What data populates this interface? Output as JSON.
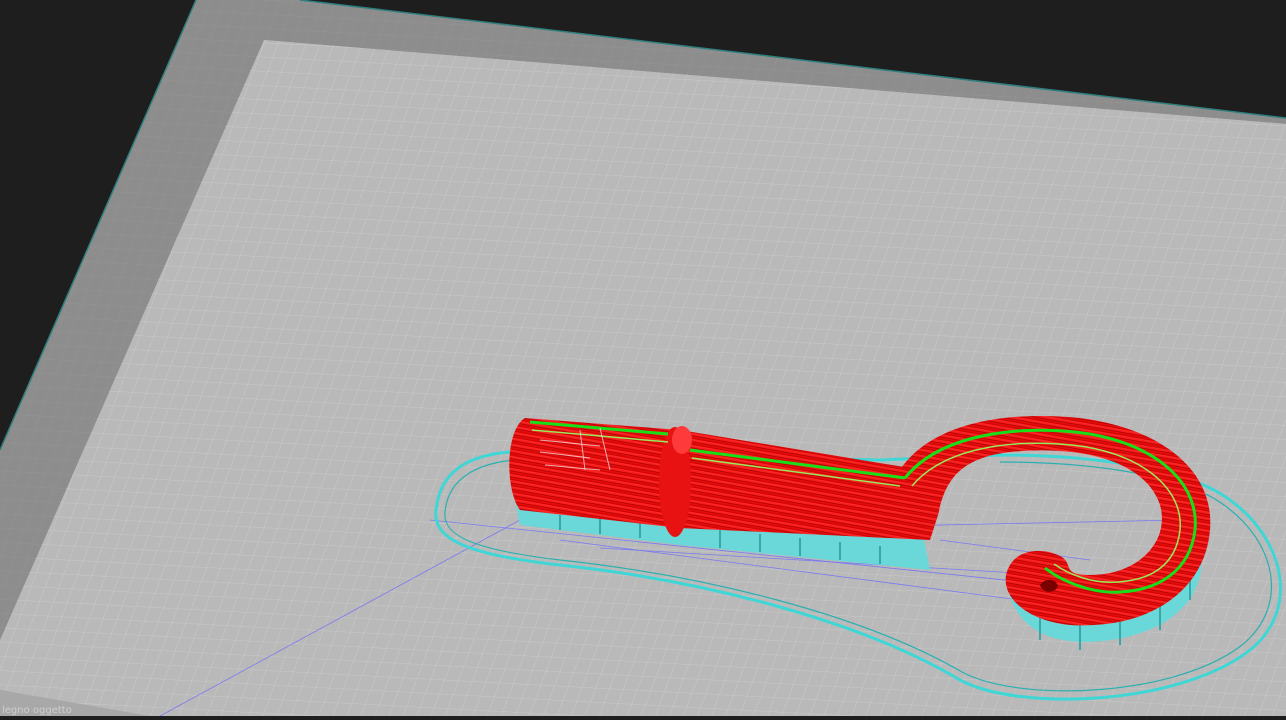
{
  "viewport": {
    "background": "#1e1e1e",
    "plate_color": "#b7b7b7",
    "plate_border_color": "#8a8a8a",
    "grid_color": "#c9c9c9",
    "skirt_color": "#3fd6d6",
    "support_color": "#68d6d6",
    "travel_color": "#6a6aff",
    "wall_color": "#ff1a1a",
    "perimeter_color": "#18e018"
  },
  "status": {
    "legend_text": "legno oggetto"
  },
  "icons": {
    "viewport": "gcode-preview-view"
  }
}
